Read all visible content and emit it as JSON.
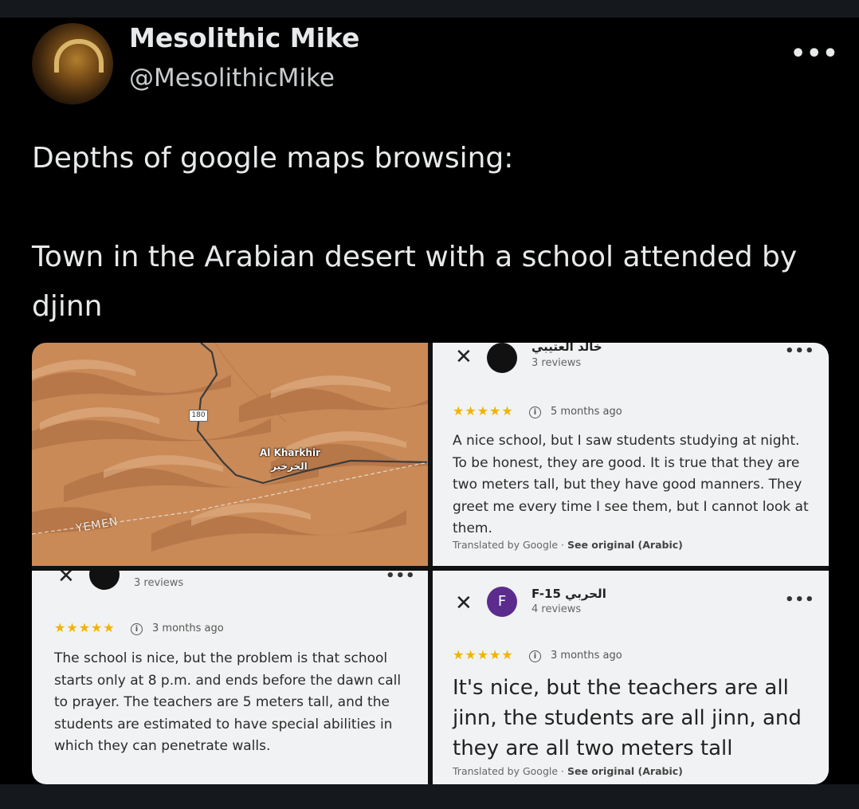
{
  "tweet": {
    "author_name": "Mesolithic Mike",
    "author_handle": "@MesolithicMike",
    "more_label": "•••",
    "text": "Depths of google maps browsing:\n\nTown in the Arabian desert with a school attended by djinn"
  },
  "map": {
    "road_shield": "180",
    "town_label_en": "Al Kharkhir",
    "town_label_ar": "الخرخير",
    "country_label": "YEMEN",
    "colors": {
      "sand": "#c98a58",
      "dune_shadow": "#a8683d",
      "road": "#3b3b3b"
    }
  },
  "reviews": [
    {
      "close": "✕",
      "name": "خالد العتيبي",
      "count": "3 reviews",
      "more": "•••",
      "stars": "★★★★★",
      "time": "5 months ago",
      "text": "A nice school, but I saw students studying at night. To be honest, they are good. It is true that they are two meters tall, but they have good manners. They greet me every time I see them, but I cannot look at them.",
      "translated_by": "Translated by Google",
      "see_original": "See original (Arabic)"
    },
    {
      "close": "✕",
      "count": "3 reviews",
      "more": "•••",
      "stars": "★★★★★",
      "time": "3 months ago",
      "text": "The school is nice, but the problem is that school starts only at 8 p.m. and ends before the dawn call to prayer. The teachers are 5 meters tall, and the students are estimated to have special abilities in which they can penetrate walls."
    },
    {
      "close": "✕",
      "avatar_letter": "F",
      "name": "F-15 الحربي",
      "count": "4 reviews",
      "more": "•••",
      "stars": "★★★★★",
      "time": "3 months ago",
      "text": "It's nice, but the teachers are all jinn, the students are all jinn, and they are all two meters tall",
      "translated_by": "Translated by Google",
      "see_original": "See original (Arabic)"
    }
  ],
  "colors": {
    "background": "#000000",
    "text": "#e7e9ea",
    "star": "#f0b400",
    "avatar_f": "#5b2c8e"
  }
}
